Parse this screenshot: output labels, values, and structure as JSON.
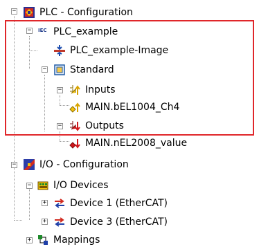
{
  "tree": {
    "plc_configuration": "PLC - Configuration",
    "plc_example": "PLC_example",
    "plc_example_image": "PLC_example-Image",
    "standard": "Standard",
    "inputs": "Inputs",
    "input_var": "MAIN.bEL1004_Ch4",
    "outputs": "Outputs",
    "output_var": "MAIN.nEL2008_value",
    "io_configuration": "I/O - Configuration",
    "io_devices": "I/O Devices",
    "device1": "Device 1 (EtherCAT)",
    "device3": "Device 3 (EtherCAT)",
    "mappings": "Mappings"
  },
  "iec_badge": "IEC 1131",
  "expanders": {
    "expanded": "−",
    "collapsed": "+"
  },
  "colors": {
    "highlight_border": "#e0262a",
    "tree_lines": "#9a9a9a",
    "input_arrow": "#d9a400",
    "output_arrow": "#d2161b"
  },
  "icons": {
    "plc_configuration": "plc-config-icon",
    "plc_example": "iec-project-icon",
    "plc_example_image": "process-image-icon",
    "standard": "task-icon",
    "inputs": "inputs-icon",
    "input_var": "input-variable-icon",
    "outputs": "outputs-icon",
    "output_var": "output-variable-icon",
    "io_configuration": "io-config-icon",
    "io_devices": "io-devices-icon",
    "device": "ethercat-device-icon",
    "mappings": "mappings-icon"
  }
}
